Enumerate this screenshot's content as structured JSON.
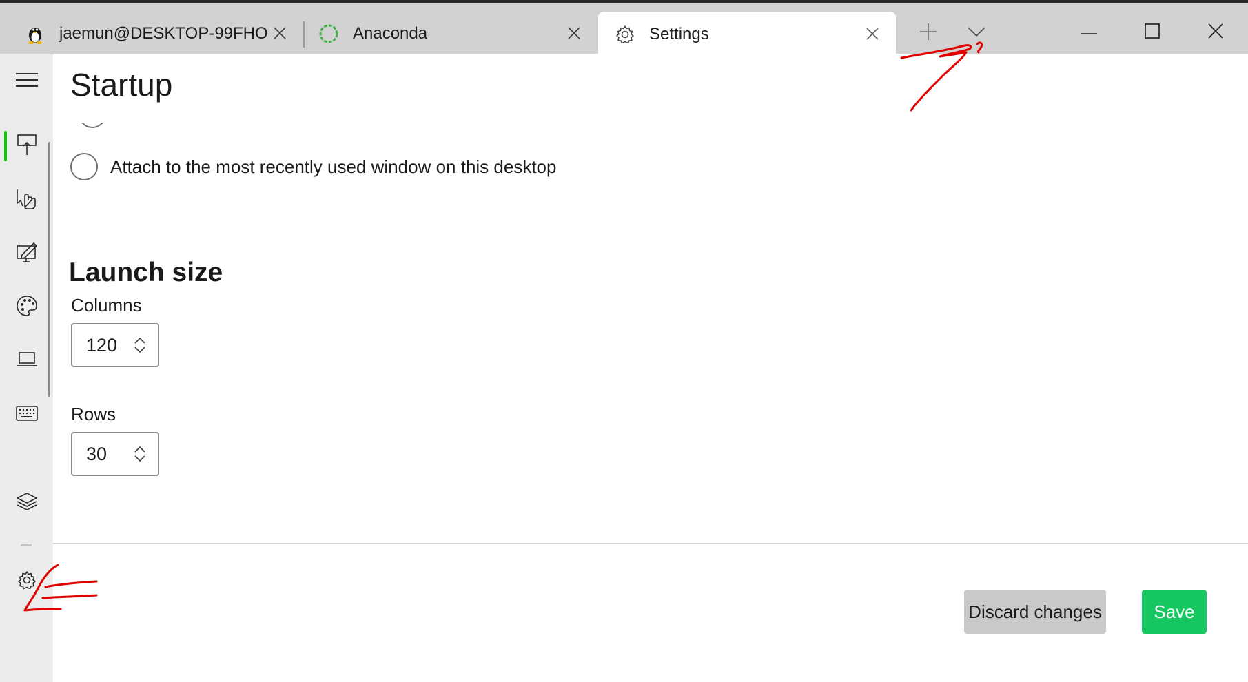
{
  "tabs": [
    {
      "label": "jaemun@DESKTOP-99FHO",
      "icon": "linux-penguin-icon"
    },
    {
      "label": "Anaconda",
      "icon": "anaconda-icon"
    },
    {
      "label": "Settings",
      "icon": "gear-icon",
      "active": true
    }
  ],
  "nav": {
    "items": [
      "startup-icon",
      "interaction-icon",
      "appearance-icon",
      "color-palette-icon",
      "rendering-icon",
      "keyboard-icon",
      "layers-icon",
      "gear-icon"
    ],
    "active_index": 0
  },
  "page": {
    "title": "Startup",
    "radio_option_label": "Attach to the most recently used window on this desktop",
    "section_title": "Launch size",
    "columns_label": "Columns",
    "columns_value": "120",
    "rows_label": "Rows",
    "rows_value": "30"
  },
  "footer": {
    "discard_label": "Discard changes",
    "save_label": "Save"
  },
  "colors": {
    "accent": "#16c60c",
    "save_button": "#16c660",
    "annotation": "#e00000"
  }
}
